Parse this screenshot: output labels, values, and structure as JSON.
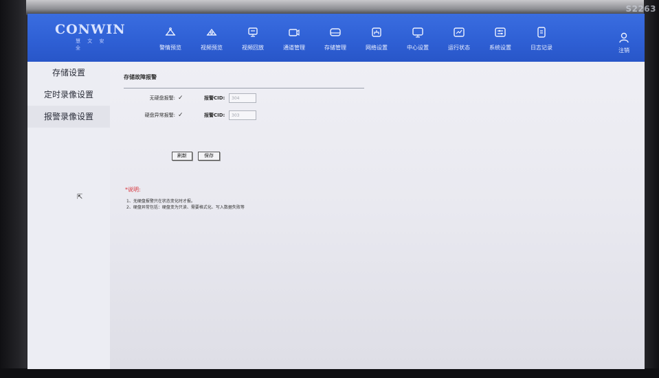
{
  "monitor": {
    "model_mark": "S2263"
  },
  "brand": {
    "name": "CONWIN",
    "subtitle": "慧 文 安 全"
  },
  "nav": [
    {
      "label": "警情预览",
      "icon": "bell-icon"
    },
    {
      "label": "视频预览",
      "icon": "camera-icon"
    },
    {
      "label": "视频回放",
      "icon": "playback-icon"
    },
    {
      "label": "通道管理",
      "icon": "channel-icon"
    },
    {
      "label": "存储管理",
      "icon": "storage-icon"
    },
    {
      "label": "网络设置",
      "icon": "network-icon"
    },
    {
      "label": "中心设置",
      "icon": "monitor-icon"
    },
    {
      "label": "运行状态",
      "icon": "status-icon"
    },
    {
      "label": "系统设置",
      "icon": "system-icon"
    },
    {
      "label": "日志记录",
      "icon": "log-icon"
    }
  ],
  "logout": {
    "label": "注销",
    "icon": "user-icon"
  },
  "sidebar": {
    "items": [
      {
        "label": "存储设置"
      },
      {
        "label": "定时录像设置"
      },
      {
        "label": "报警录像设置"
      }
    ]
  },
  "form": {
    "title": "存储故障报警",
    "rows": [
      {
        "label": "无硬盘报警:",
        "checked": true,
        "cid_label": "报警CID:",
        "cid_value": "304"
      },
      {
        "label": "硬盘异常报警:",
        "checked": true,
        "cid_label": "报警CID:",
        "cid_value": "303"
      }
    ],
    "refresh_label": "刷新",
    "save_label": "保存"
  },
  "notes": {
    "title": "*说明:",
    "lines": [
      "1、无硬盘报警只在状态变化时才报。",
      "2、硬盘异常包括：硬盘变为只读、需要格式化、写入数据失败等"
    ]
  },
  "colors": {
    "topbar": "#2e5fd4",
    "note_red": "#d8343c",
    "background": "#ececf2"
  }
}
